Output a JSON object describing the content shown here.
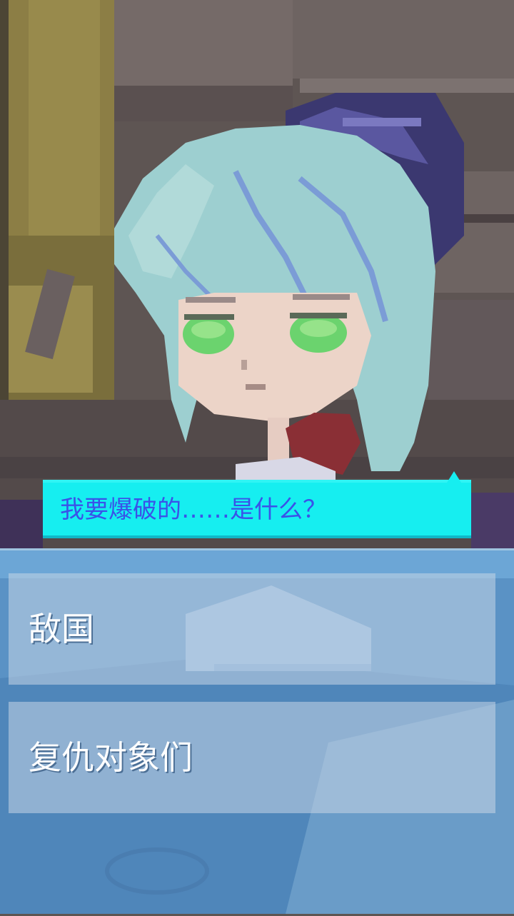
{
  "dialogue": {
    "text": "我要爆破的……是什么？"
  },
  "choices": [
    {
      "label": "敌国"
    },
    {
      "label": "复仇对象们"
    }
  ],
  "colors": {
    "bubble": "#16eef0",
    "bubble_text": "#3a52e8",
    "choice_panel": "#5a93c4",
    "choice_text": "#ffffff"
  }
}
